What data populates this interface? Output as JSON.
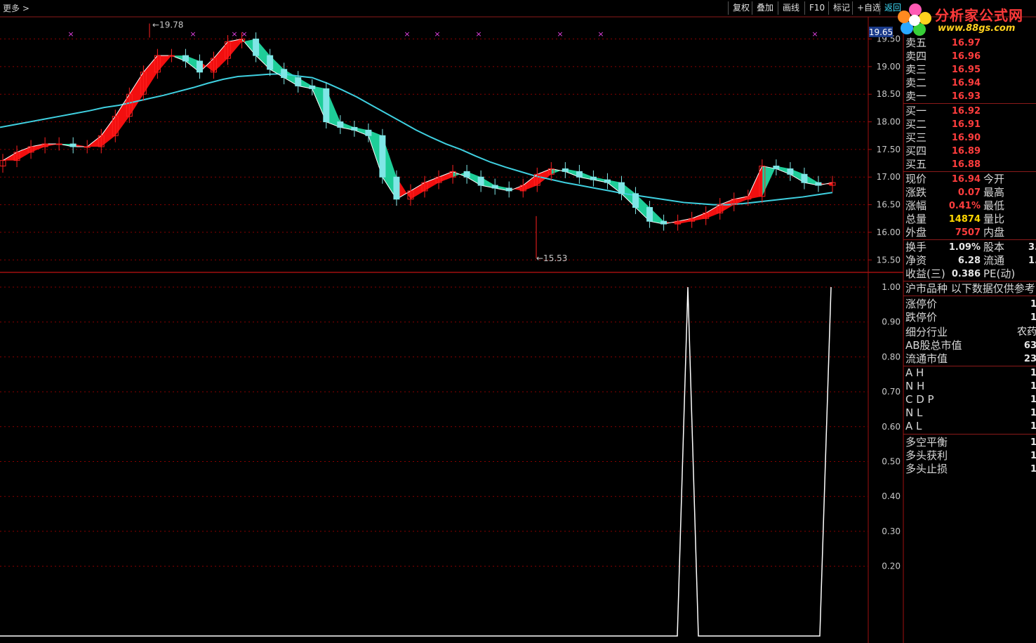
{
  "toolbar": {
    "more_label": "更多 >",
    "buttons": [
      "复权",
      "叠加",
      "画线",
      "F10",
      "标记",
      "+自选",
      "返回"
    ]
  },
  "logo": {
    "title": "分析家公式网",
    "url": "www.88gs.com"
  },
  "colors": {
    "up": "#ff2020",
    "down": "#7fe6e6",
    "ma_long": "#3fd0e0",
    "ma_short": "#ffffff",
    "fill_up": "#ff1010",
    "fill_down": "#20d8a0",
    "grid": "#8b0000",
    "marker": "#e040e0"
  },
  "price_labels": {
    "current_box": "19.65",
    "high": "19.78",
    "low": "15.53"
  },
  "top_axis": [
    "19.50",
    "19.00",
    "18.50",
    "18.00",
    "17.50",
    "17.00",
    "16.50",
    "16.00",
    "15.50"
  ],
  "bottom_axis": [
    "1.00",
    "0.90",
    "0.80",
    "0.70",
    "0.60",
    "0.50",
    "0.40",
    "0.30",
    "0.20"
  ],
  "quotes": {
    "sell": [
      {
        "label": "卖五",
        "price": "16.97"
      },
      {
        "label": "卖四",
        "price": "16.96"
      },
      {
        "label": "卖三",
        "price": "16.95"
      },
      {
        "label": "卖二",
        "price": "16.94"
      },
      {
        "label": "卖一",
        "price": "16.93"
      }
    ],
    "buy": [
      {
        "label": "买一",
        "price": "16.92"
      },
      {
        "label": "买二",
        "price": "16.91"
      },
      {
        "label": "买三",
        "price": "16.90"
      },
      {
        "label": "买四",
        "price": "16.89"
      },
      {
        "label": "买五",
        "price": "16.88"
      }
    ]
  },
  "stats": [
    {
      "label": "现价",
      "value": "16.94",
      "label2": "今开"
    },
    {
      "label": "涨跌",
      "value": "0.07",
      "label2": "最高"
    },
    {
      "label": "涨幅",
      "value": "0.41%",
      "label2": "最低"
    },
    {
      "label": "总量",
      "value": "14874",
      "label2": "量比"
    },
    {
      "label": "外盘",
      "value": "7507",
      "label2": "内盘"
    }
  ],
  "fundamentals": [
    {
      "label": "换手",
      "value": "1.09%",
      "label2": "股本",
      "value2": "3."
    },
    {
      "label": "净资",
      "value": "6.28",
      "label2": "流通",
      "value2": "1."
    },
    {
      "label": "收益(三)",
      "value": "0.386",
      "label2": "PE(动)",
      "value2": ""
    }
  ],
  "info": {
    "header": "沪市品种  以下数据仅供参考",
    "rows": [
      {
        "label": "涨停价",
        "value": "1"
      },
      {
        "label": "跌停价",
        "value": "1"
      },
      {
        "label": "细分行业",
        "value": "农药"
      },
      {
        "label": "AB股总市值",
        "value": "63"
      },
      {
        "label": "流通市值",
        "value": "23"
      }
    ],
    "indicators": [
      {
        "label": "A H",
        "value": "1"
      },
      {
        "label": "N H",
        "value": "1"
      },
      {
        "label": "C D P",
        "value": "1"
      },
      {
        "label": "N L",
        "value": "1"
      },
      {
        "label": "A L",
        "value": "1"
      }
    ],
    "balance": [
      {
        "label": "多空平衡",
        "value": "1"
      },
      {
        "label": "多头获利",
        "value": "1"
      },
      {
        "label": "多头止损",
        "value": "1"
      }
    ]
  },
  "chart_data": [
    {
      "type": "candlestick",
      "title": "",
      "ylim": [
        15.3,
        19.85
      ],
      "ticks": [
        19.5,
        19.0,
        18.5,
        18.0,
        17.5,
        17.0,
        16.5,
        16.0,
        15.5
      ],
      "high_marker": 19.78,
      "low_marker": 15.53,
      "ma_long": [
        17.9,
        17.95,
        18.0,
        18.05,
        18.1,
        18.15,
        18.2,
        18.26,
        18.3,
        18.36,
        18.42,
        18.48,
        18.55,
        18.62,
        18.7,
        18.77,
        18.82,
        18.84,
        18.86,
        18.87,
        18.83,
        18.8,
        18.7,
        18.58,
        18.45,
        18.3,
        18.15,
        18.0,
        17.85,
        17.72,
        17.6,
        17.5,
        17.38,
        17.27,
        17.18,
        17.1,
        17.02,
        16.96,
        16.9,
        16.85,
        16.8,
        16.75,
        16.7,
        16.66,
        16.62,
        16.58,
        16.54,
        16.52,
        16.5,
        16.5,
        16.52,
        16.55,
        16.58,
        16.61,
        16.64,
        16.68,
        16.72
      ],
      "ma_short": [
        17.3,
        17.45,
        17.55,
        17.6,
        17.6,
        17.55,
        17.55,
        17.75,
        18.1,
        18.5,
        18.9,
        19.2,
        19.2,
        19.1,
        18.9,
        19.15,
        19.45,
        19.5,
        19.2,
        18.95,
        18.8,
        18.65,
        18.6,
        18.0,
        17.9,
        17.85,
        17.75,
        17.0,
        16.6,
        16.75,
        16.9,
        17.0,
        17.1,
        17.0,
        16.85,
        16.8,
        16.75,
        16.85,
        17.05,
        17.15,
        17.1,
        17.0,
        16.95,
        16.9,
        16.7,
        16.45,
        16.2,
        16.15,
        16.2,
        16.25,
        16.35,
        16.5,
        16.6,
        16.65,
        17.2,
        17.15,
        17.05,
        16.9,
        16.85,
        16.9
      ]
    },
    {
      "type": "line",
      "title": "",
      "ylim": [
        0.0,
        1.0
      ],
      "ticks": [
        1.0,
        0.9,
        0.8,
        0.7,
        0.6,
        0.5,
        0.4,
        0.3,
        0.2
      ],
      "x": [
        0,
        965,
        980,
        995,
        1168,
        1184
      ],
      "values": [
        0,
        0,
        1.0,
        0,
        0,
        1.0
      ]
    }
  ]
}
